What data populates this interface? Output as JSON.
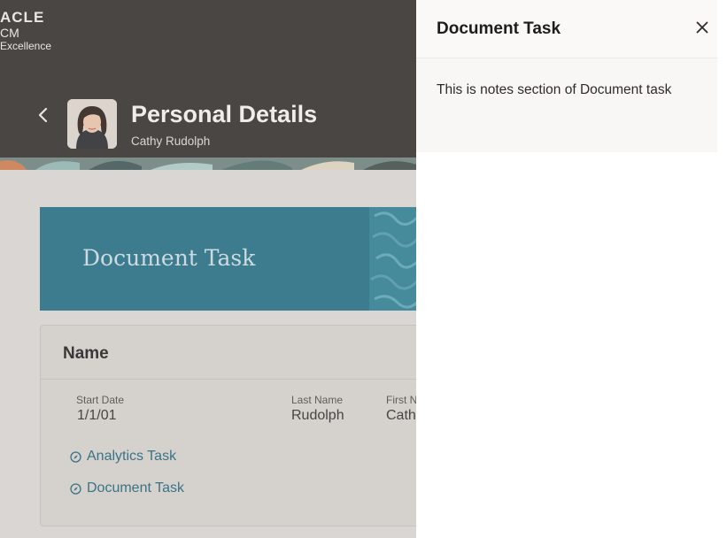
{
  "brand": {
    "line1": "ACLE",
    "line2": "CM",
    "line3": "Excellence"
  },
  "header": {
    "title": "Personal Details",
    "subtitle": "Cathy Rudolph"
  },
  "banner": {
    "title": "Document Task"
  },
  "name_card": {
    "title": "Name",
    "fields": [
      {
        "label": "Start Date",
        "value": "1/1/01"
      },
      {
        "label": "Last Name",
        "value": "Rudolph"
      },
      {
        "label": "First N",
        "value": "Cath"
      }
    ],
    "links": [
      {
        "label": "Analytics Task",
        "icon": "compass-icon"
      },
      {
        "label": "Document Task",
        "icon": "compass-icon"
      }
    ]
  },
  "drawer": {
    "title": "Document Task",
    "notes": "This is notes section of Document task",
    "close_icon": "close-icon"
  },
  "colors": {
    "header_bg": "#312d2a",
    "banner_bg": "#216a7f",
    "link": "#1f5f75",
    "drawer_bg": "#ffffff"
  }
}
